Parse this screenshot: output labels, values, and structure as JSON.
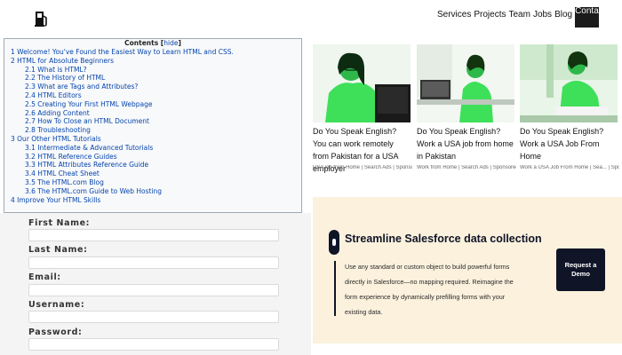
{
  "nav": {
    "items": [
      "Services",
      "Projects",
      "Team",
      "Jobs",
      "Blog"
    ],
    "contact": "Contact"
  },
  "toc": {
    "title": "Contents",
    "hide": "hide",
    "items": [
      {
        "text": "1 Welcome! You've Found the Easiest Way to Learn HTML and CSS.",
        "level": 1
      },
      {
        "text": "2 HTML for Absolute Beginners",
        "level": 1
      },
      {
        "text": "2.1 What is HTML?",
        "level": 2
      },
      {
        "text": "2.2 The History of HTML",
        "level": 2
      },
      {
        "text": "2.3 What are Tags and Attributes?",
        "level": 2
      },
      {
        "text": "2.4 HTML Editors",
        "level": 2
      },
      {
        "text": "2.5 Creating Your First HTML Webpage",
        "level": 2
      },
      {
        "text": "2.6 Adding Content",
        "level": 2
      },
      {
        "text": "2.7 How To Close an HTML Document",
        "level": 2
      },
      {
        "text": "2.8 Troubleshooting",
        "level": 2
      },
      {
        "text": "3 Our Other HTML Tutorials",
        "level": 1
      },
      {
        "text": "3.1 Intermediate & Advanced Tutorials",
        "level": 2
      },
      {
        "text": "3.2 HTML Reference Guides",
        "level": 2
      },
      {
        "text": "3.3 HTML Attributes Reference Guide",
        "level": 2
      },
      {
        "text": "3.4 HTML Cheat Sheet",
        "level": 2
      },
      {
        "text": "3.5 The HTML.com Blog",
        "level": 2
      },
      {
        "text": "3.6 The HTML.com Guide to Web Hosting",
        "level": 2
      },
      {
        "text": "4 Improve Your HTML Skills",
        "level": 1
      }
    ]
  },
  "form": {
    "first_name": "First Name:",
    "last_name": "Last Name:",
    "email": "Email:",
    "username": "Username:",
    "password": "Password:"
  },
  "ads": [
    {
      "title": "Do You Speak English? You can work remotely from Pakistan for a USA employer",
      "meta": "USA job from Home | Search Ads | Sponsored"
    },
    {
      "title": "Do You Speak English? Work a USA job from home in Pakistan",
      "meta": "Work from Home | Search Ads | Sponsored"
    },
    {
      "title": "Do You Speak English? Work a USA Job From Home",
      "meta": "Work a USA Job From Home | Sea... | Sponsored"
    }
  ],
  "banner": {
    "title": "Streamline Salesforce data collection",
    "text": "Use any standard or custom object to build powerful forms directly in Salesforce—no mapping required. Reimagine the form experience by dynamically prefilling forms with your existing data.",
    "button": "Request a Demo"
  },
  "colors": {
    "link": "#0645ad",
    "ad_image_green": "#3ee05a",
    "banner_bg": "#fbf1dd",
    "banner_dark": "#0f1427"
  }
}
